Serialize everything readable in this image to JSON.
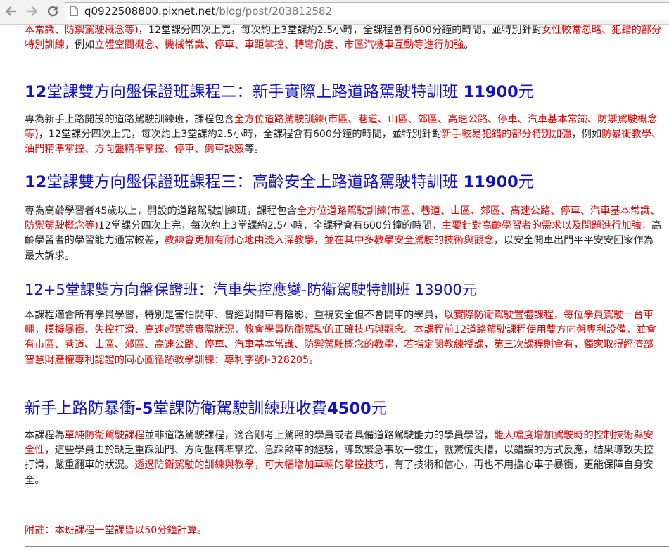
{
  "browser": {
    "url_domain": "q0922508800.pixnet.net",
    "url_path": "/blog/post/203812582"
  },
  "content": {
    "p0": {
      "a": "本常識、防禦駕駛概念等)",
      "b": "，12堂課分四次上完，每次約上3堂課約2.5小時，全課程會有600分鐘的時間，並特別針對",
      "c": "女性較常忽略、犯錯的部分特別訓練",
      "d": "，例如",
      "e": "立體空間概念、機械常識、停車、車距掌控、轉彎角度、市區汽機車互動等進行加強",
      "f": "。"
    },
    "h1": {
      "n1": "12",
      "t1": "堂課雙方向盤保證班課程二：新手實際上路道路駕駛特訓班",
      "n2": "11900",
      "t2": "元"
    },
    "p1": {
      "a": "專為新手上路開設的道路駕駛訓練班，課程包含",
      "b": "全方位道路駕駛訓練(市區、巷道、山區、郊區、高速公路、停車、汽車基本常識、防禦駕駛概念等)",
      "c": "，12堂課分四次上完，每次約上3堂課約2.5小時，全課程會有600分鐘的時間，並特別針對",
      "d": "新手較易犯錯的部分特別加強",
      "e": "，例如",
      "f": "防暴衝教學、油門精準掌控、方向盤精準掌控、停車、倒車訣竅",
      "g": "等。"
    },
    "h2": {
      "n1": "12",
      "t1": "堂課雙方向盤保證班課程三：高齡安全上路道路駕駛特訓班",
      "n2": "11900",
      "t2": "元"
    },
    "p2": {
      "a": "專為高齡學習者45歲以上，開設的道路駕駛訓練班，課程包含",
      "b": "全方位道路駕駛訓練(市區、巷道、山區、郊區、高速公路、停車、汽車基本常識、防禦駕駛概念等)",
      "c": "12堂課分四次上完，每次約上3堂課約2.5小時，全課程會有600分鐘的時間，",
      "d": "主要針對高齡學習者的需求以及問題進行加強",
      "e": "，高齡學習者的學習能力通常較差，",
      "f": "教練會更加有耐心地由淺入深教學，並在其中多教學安全駕駛的技術與觀念",
      "g": "，以安全開車出門平平安安回家作為最大訴求。"
    },
    "h3": {
      "t": "12+5堂課雙方向盤保證班：汽車失控應變-防衛駕駛特訓班 13900元"
    },
    "p3": {
      "a": "本課程適合所有學員學習，特別是害怕開車、曾經對開車有陰影、重視安全但不會開車的學員，",
      "b": "以實際防衛駕駛置體課程，每位學員駕駛一台車輛，模擬暴衝、失控打滑、高速超駕等實際狀況，教會學員防衛駕駛的正確技巧與觀念。本課程前12道路駕駛課程使用雙方向盤專利設備，並會有市區、巷道、山區、郊區、高速公路、停車、汽車基本常識、防禦駕駛概念的教學，若指定閔教練授課，第三次課程則會有，獨家取得經濟部智慧財產權專利認證的同心圓循跡教學訓練：專利字號I-328205",
      "c": "。"
    },
    "h4": {
      "t1": "新手上路防暴衝",
      "n1": "-5",
      "t2": "堂課防衛駕駛訓練班收費",
      "n2": "4500",
      "t3": "元"
    },
    "p4": {
      "a": "本課程為",
      "b": "單純防衛駕駛課程",
      "c": "並非道路駕駛課程，適合剛考上駕照的學員或者具備道路駕駛能力的學員學習，",
      "d": "能大幅度增加駕駛時的控制技術與安全性",
      "e": "，這些學員由於缺乏重踩油門、方向盤精準掌控、急踩煞車的經驗，導致緊急事故一發生，就驚慌失措，以錯誤的方式反應，結果導致失控打滑，嚴重翻車的狀況。",
      "f": "透過防衛駕駛的訓練與教學，可大幅增加車輛的掌控技巧",
      "g": "，有了技術和信心，再也不用擔心車子暴衝，更能保障自身安全。"
    },
    "note": {
      "t": "附註：本班課程一堂課皆以50分鐘計算。"
    }
  }
}
